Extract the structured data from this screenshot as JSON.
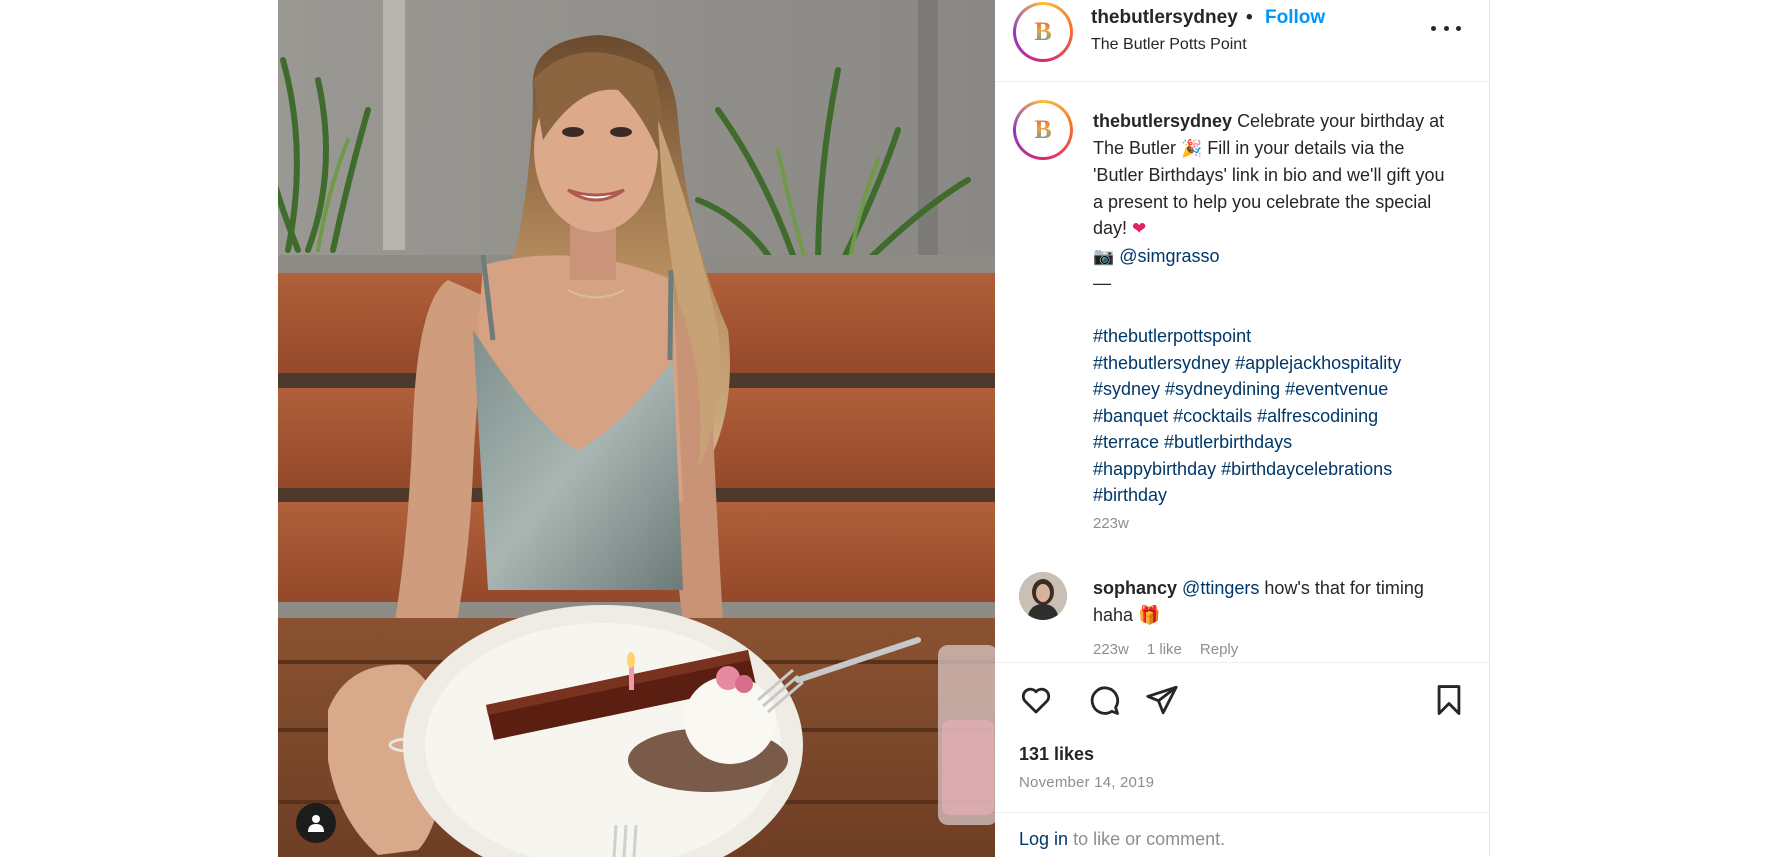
{
  "post": {
    "username": "thebutlersydney",
    "dot": "•",
    "follow_label": "Follow",
    "location": "The Butler Potts Point",
    "avatar_letter": "B"
  },
  "caption": {
    "username": "thebutlersydney",
    "text_1": "Celebrate your birthday at The Butler",
    "emoji_1": "🎉",
    "text_2": "Fill in your details via the 'Butler Birthdays' link in bio and we'll gift you a present to help you celebrate the special day!",
    "emoji_2": "❤",
    "camera_emoji": "📷",
    "credit": "@simgrasso",
    "divider": "—",
    "hashtags_line_1": "#thebutlerpottspoint",
    "hashtags_line_2": "#thebutlersydney #applejackhospitality",
    "hashtags_line_3": "#sydney #sydneydining #eventvenue",
    "hashtags_line_4": "#banquet #cocktails #alfrescodining",
    "hashtags_line_5": "#terrace #butlerbirthdays",
    "hashtags_line_6": "#happybirthday #birthdaycelebrations",
    "hashtags_line_7": "#birthday",
    "time": "223w"
  },
  "comment": {
    "username": "sophancy",
    "mention": "@ttingers",
    "text": "how's that for timing haha",
    "emoji": "🎁",
    "time": "223w",
    "likes": "1 like",
    "reply_label": "Reply"
  },
  "icons": {
    "like": "heart-icon",
    "comment": "comment-icon",
    "share": "share-icon",
    "save": "bookmark-icon",
    "more": "more-options-icon",
    "user_tag": "user-tag-icon"
  },
  "likes_text": "131 likes",
  "date_text": "November 14, 2019",
  "login": {
    "link_label": "Log in",
    "rest_text": "to like or comment."
  },
  "colors": {
    "follow": "#0095f6",
    "link": "#00376b",
    "muted": "#8e8e8e"
  }
}
